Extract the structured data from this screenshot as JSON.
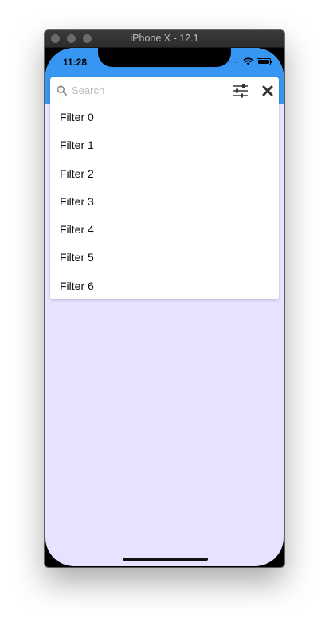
{
  "window": {
    "title": "iPhone X - 12.1"
  },
  "status_bar": {
    "time": "11:28",
    "signal_text": "...."
  },
  "search": {
    "placeholder": "Search",
    "value": ""
  },
  "filters": [
    "Filter 0",
    "Filter 1",
    "Filter 2",
    "Filter 3",
    "Filter 4",
    "Filter 5",
    "Filter 6"
  ],
  "icons": {
    "search": "search-icon",
    "filter": "sliders-icon",
    "close": "close-icon",
    "wifi": "wifi-icon",
    "battery": "battery-icon"
  },
  "colors": {
    "header": "#3796f2",
    "background": "#e6e2ff",
    "card": "#ffffff",
    "placeholder": "#bdbdbd"
  }
}
